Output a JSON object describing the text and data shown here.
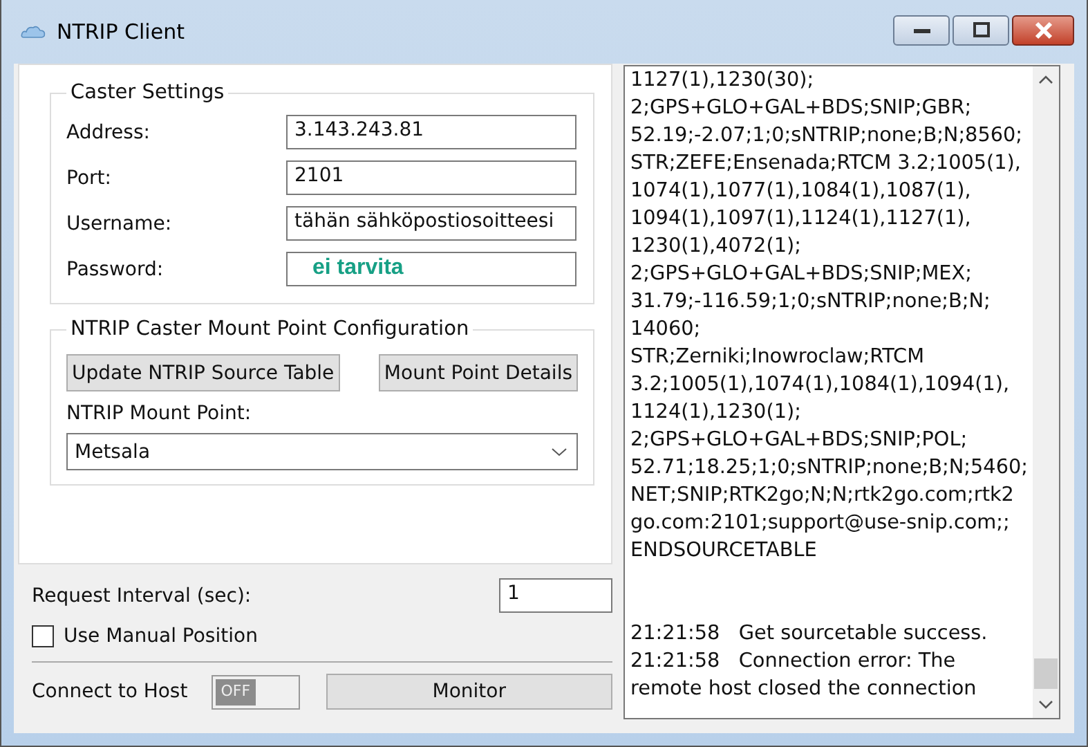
{
  "window": {
    "title": "NTRIP Client"
  },
  "caster_settings": {
    "title": "Caster Settings",
    "fields": [
      {
        "label": "Address:",
        "value": "3.143.243.81",
        "kind": "text"
      },
      {
        "label": "Port:",
        "value": "2101",
        "kind": "text"
      },
      {
        "label": "Username:",
        "value": "tähän sähköpostiosoitteesi",
        "kind": "text"
      },
      {
        "label": "Password:",
        "value": "ei tarvita",
        "kind": "note"
      }
    ]
  },
  "mount_point_configuration": {
    "title": "NTRIP Caster Mount Point Configuration",
    "buttons": [
      "Update NTRIP Source Table",
      "Mount Point Details"
    ],
    "mount_point_label": "NTRIP Mount Point:",
    "mount_point_value": "Metsala"
  },
  "request_interval": {
    "label": "Request Interval (sec):",
    "value": "1"
  },
  "manual_position": {
    "label": "Use Manual Position",
    "checked": false
  },
  "connect": {
    "label": "Connect to Host",
    "toggle_text": "OFF",
    "on": false
  },
  "monitor_button": "Monitor",
  "log": {
    "source_lines": [
      "1127(1),1230(30);",
      "2;GPS+GLO+GAL+BDS;SNIP;GBR;",
      "52.19;-2.07;1;0;sNTRIP;none;B;N;8560;",
      "STR;ZEFE;Ensenada;RTCM 3.2;1005(1),",
      "1074(1),1077(1),1084(1),1087(1),",
      "1094(1),1097(1),1124(1),1127(1),",
      "1230(1),4072(1);",
      "2;GPS+GLO+GAL+BDS;SNIP;MEX;",
      "31.79;-116.59;1;0;sNTRIP;none;B;N;",
      "14060;",
      "STR;Zerniki;Inowroclaw;RTCM",
      "3.2;1005(1),1074(1),1084(1),1094(1),",
      "1124(1),1230(1);",
      "2;GPS+GLO+GAL+BDS;SNIP;POL;",
      "52.71;18.25;1;0;sNTRIP;none;B;N;5460;",
      "NET;SNIP;RTK2go;N;N;rtk2go.com;rtk2",
      "go.com:2101;support@use-snip.com;;",
      "ENDSOURCETABLE"
    ],
    "messages": [
      {
        "time": "21:21:58",
        "text": "Get sourcetable success."
      },
      {
        "time": "21:21:58",
        "text": "Connection error: The remote host closed the connection"
      }
    ]
  }
}
